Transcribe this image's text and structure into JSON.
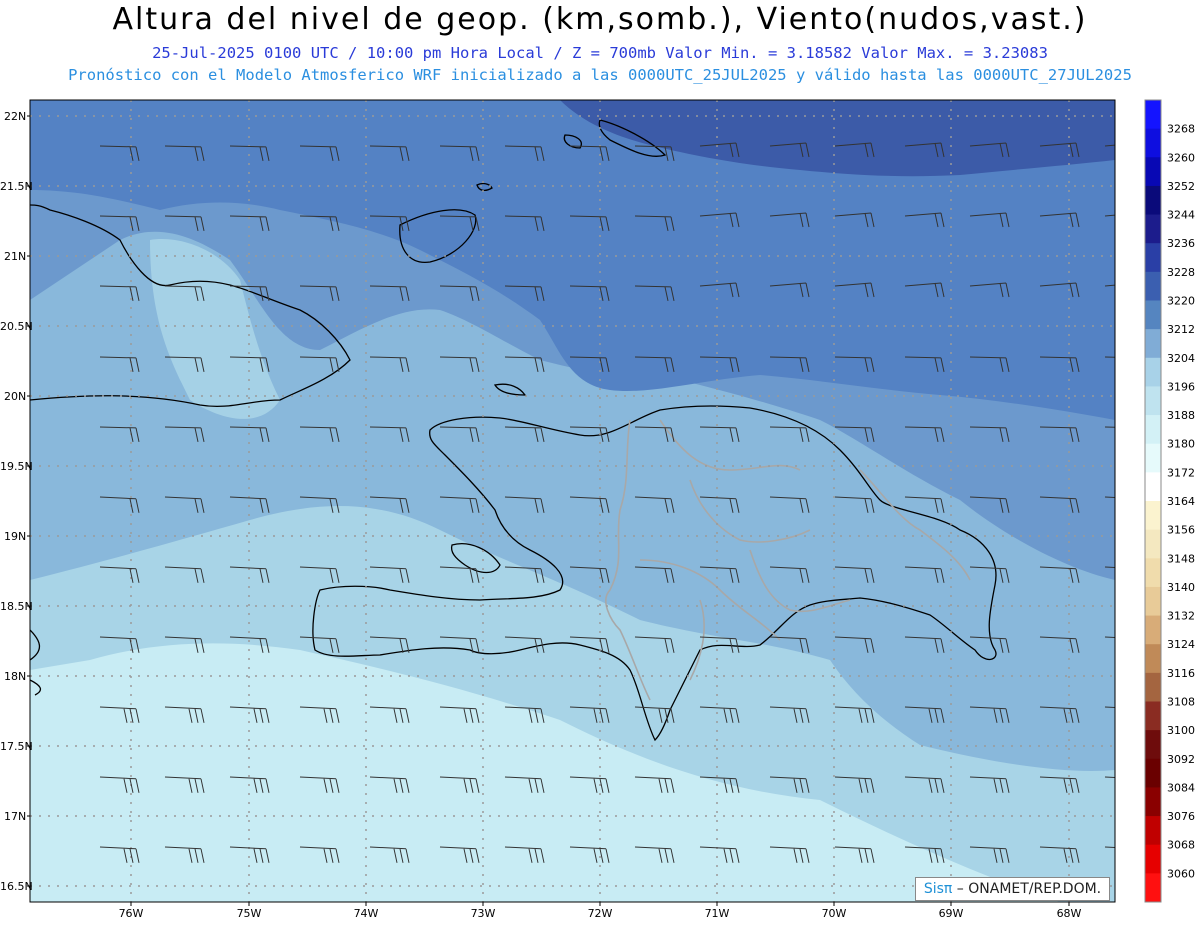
{
  "title": "Altura del nivel de geop. (km,somb.), Viento(nudos,vast.)",
  "subtitle_line1": "25-Jul-2025  0100 UTC / 10:00 pm Hora Local / Z = 700mb   Valor Min. = 3.18582  Valor Max. = 3.23083",
  "subtitle_line2": "Pronóstico con el Modelo Atmosferico WRF inicializado a las 0000UTC_25JUL2025 y válido hasta las  0000UTC_27JUL2025",
  "credit": {
    "brand": "Sisπ",
    "text": " – ONAMET/REP.DOM."
  },
  "lat_labels": [
    "22N",
    "21.5N",
    "21N",
    "20.5N",
    "20N",
    "19.5N",
    "19N",
    "18.5N",
    "18N",
    "17.5N",
    "17N",
    "16.5N"
  ],
  "lon_labels": [
    "76W",
    "75W",
    "74W",
    "73W",
    "72W",
    "71W",
    "70W",
    "69W",
    "68W"
  ],
  "colorbar": {
    "labels": [
      "3268",
      "3260",
      "3252",
      "3244",
      "3236",
      "3228",
      "3220",
      "3212",
      "3204",
      "3196",
      "3188",
      "3180",
      "3172",
      "3164",
      "3156",
      "3148",
      "3140",
      "3132",
      "3124",
      "3116",
      "3108",
      "3100",
      "3092",
      "3084",
      "3076",
      "3068",
      "3060"
    ],
    "colors": [
      "#1414ff",
      "#0e0ee0",
      "#0808b4",
      "#0a0a7a",
      "#1c1c8c",
      "#2a3fa6",
      "#3b5fb0",
      "#5585c0",
      "#80acd6",
      "#a8d2e8",
      "#bfe3ef",
      "#d3f1f6",
      "#e6fafb",
      "#ffffff",
      "#fbf3cf",
      "#f4e8c0",
      "#f0dcac",
      "#e8cb98",
      "#d8ac78",
      "#c08a58",
      "#a46540",
      "#8a2c22",
      "#6e0c0c",
      "#6a0000",
      "#8a0000",
      "#c00000",
      "#e60000",
      "#ff1010"
    ],
    "unit_note": "",
    "min_value": 3.18582,
    "max_value": 3.23083
  },
  "map_colors": {
    "ocean_light": "#c8ecf4",
    "level_3204": "#a4d2e6",
    "level_3212": "#86b6da",
    "level_3220": "#6a97cc",
    "level_3228": "#5480c4",
    "level_3236": "#3d5caa"
  }
}
